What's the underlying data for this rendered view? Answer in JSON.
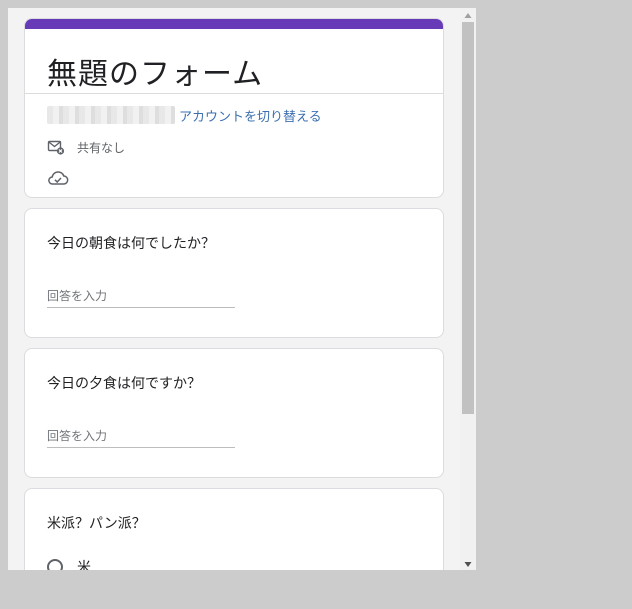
{
  "form": {
    "title": "無題のフォーム",
    "accent_color": "#673ab7"
  },
  "account": {
    "switch_label": "アカウントを切り替える"
  },
  "sharing": {
    "status": "共有なし",
    "icon": "mail-x-icon"
  },
  "save_status_icon": "cloud-check-icon",
  "questions": [
    {
      "title": "今日の朝食は何でしたか？",
      "placeholder": "回答を入力"
    },
    {
      "title": "今日の夕食は何ですか？",
      "placeholder": "回答を入力"
    },
    {
      "title": "米派？パン派？",
      "options": [
        "米"
      ]
    }
  ]
}
